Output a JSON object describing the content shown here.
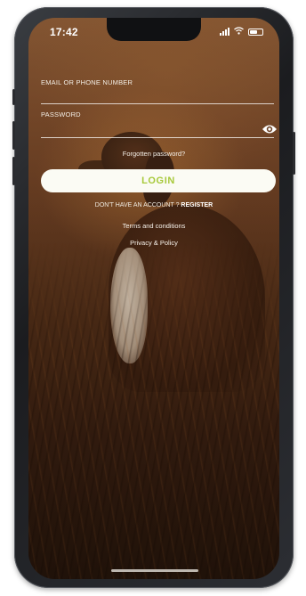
{
  "status_bar": {
    "time": "17:42"
  },
  "form": {
    "email_label": "EMAIL OR PHONE NUMBER",
    "email_value": "",
    "password_label": "PASSWORD",
    "password_value": ""
  },
  "forgot_password": "Forgotten password?",
  "login_button": "LOGIN",
  "register": {
    "prompt": "DON'T HAVE AN ACCOUNT ?",
    "link": "REGISTER"
  },
  "terms_link": "Terms and conditions",
  "privacy_link": "Privacy & Policy",
  "colors": {
    "login_text": "#a7c93a",
    "login_bg": "#fbfbf4",
    "overlay_text": "#f3eee6"
  },
  "icons": [
    "signal-icon",
    "wifi-icon",
    "battery-icon",
    "eye-icon"
  ]
}
